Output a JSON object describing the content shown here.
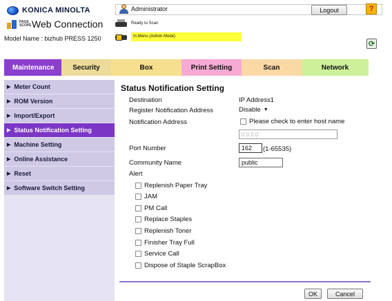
{
  "header": {
    "brand": "KONICA MINOLTA",
    "pagescope_small": "PAGE SCOPE",
    "app_title": "Web Connection",
    "model_name": "Model Name : bizhub PRESS 1250",
    "user": "Administrator",
    "logout_label": "Logout",
    "help_label": "?",
    "status_ready": "Ready to Scan",
    "status_menu": "In Menu (Admin Mode)",
    "refresh_label": "⟳"
  },
  "tabs": [
    {
      "label": "Maintenance",
      "active": true,
      "color": "#8b3fcf"
    },
    {
      "label": "Security",
      "active": false,
      "color": "#ecdb9a"
    },
    {
      "label": "Box",
      "active": false,
      "color": "#f7df90"
    },
    {
      "label": "Print Setting",
      "active": false,
      "color": "#f7aad4"
    },
    {
      "label": "Scan",
      "active": false,
      "color": "#fbd9a4"
    },
    {
      "label": "Network",
      "active": false,
      "color": "#cff09a"
    }
  ],
  "sidebar": {
    "items": [
      {
        "label": "Meter Count",
        "active": false
      },
      {
        "label": "ROM Version",
        "active": false
      },
      {
        "label": "Import/Export",
        "active": false
      },
      {
        "label": "Status Notification Setting",
        "active": true
      },
      {
        "label": "Machine Setting",
        "active": false
      },
      {
        "label": "Online Assistance",
        "active": false
      },
      {
        "label": "Reset",
        "active": false
      },
      {
        "label": "Software Switch Setting",
        "active": false
      }
    ]
  },
  "main": {
    "title": "Status Notification Setting",
    "destination_label": "Destination",
    "destination_value": "IP Address1",
    "register_label": "Register Notification Address",
    "register_value": "Disable",
    "notification_address_label": "Notification Address",
    "hostname_checkbox_label": "Please check to enter host name",
    "hostname_checked": false,
    "address_value": "0.0.0.0",
    "port_label": "Port Number",
    "port_value": "162",
    "port_range": "(1-65535)",
    "community_label": "Community Name",
    "community_value": "public",
    "alert_label": "Alert",
    "alerts": [
      {
        "label": "Replenish Paper Tray",
        "checked": false
      },
      {
        "label": "JAM",
        "checked": false
      },
      {
        "label": "PM Call",
        "checked": false
      },
      {
        "label": "Replace Staples",
        "checked": false
      },
      {
        "label": "Replenish Toner",
        "checked": false
      },
      {
        "label": "Finisher Tray Full",
        "checked": false
      },
      {
        "label": "Service Call",
        "checked": false
      },
      {
        "label": "Dispose of Staple ScrapBox",
        "checked": false
      }
    ],
    "ok_label": "OK",
    "cancel_label": "Cancel"
  }
}
